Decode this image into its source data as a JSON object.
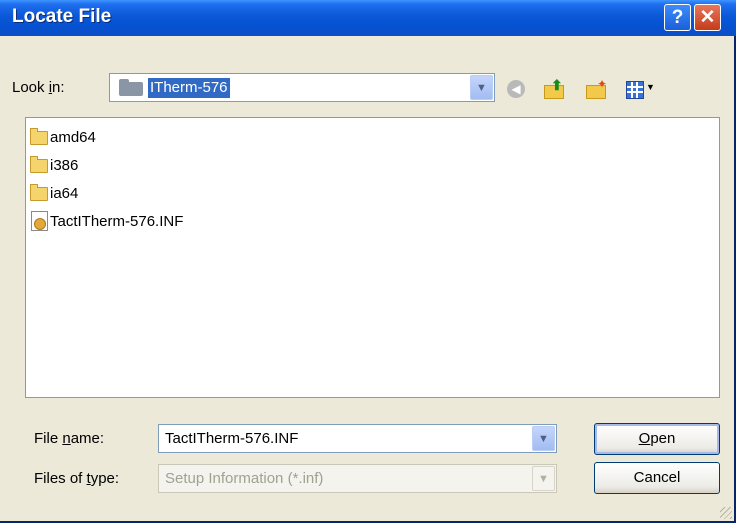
{
  "window": {
    "title": "Locate File"
  },
  "titlebar": {
    "help_glyph": "?",
    "close_glyph": "✕"
  },
  "lookin": {
    "label_pre": "Look ",
    "label_key": "i",
    "label_post": "n:",
    "value": "ITherm-576"
  },
  "toolbar": {
    "icons": [
      "back-icon",
      "up-folder-icon",
      "new-folder-icon",
      "views-menu-icon"
    ],
    "back_glyph": "◀"
  },
  "files": [
    {
      "name": "amd64",
      "kind": "folder"
    },
    {
      "name": "i386",
      "kind": "folder"
    },
    {
      "name": "ia64",
      "kind": "folder"
    },
    {
      "name": "TactITherm-576.INF",
      "kind": "inf-file"
    }
  ],
  "filename": {
    "label_pre": "File ",
    "label_key": "n",
    "label_post": "ame:",
    "value": "TactITherm-576.INF"
  },
  "filetype": {
    "label_pre": "Files of ",
    "label_key": "t",
    "label_post": "ype:",
    "value": "Setup Information (*.inf)"
  },
  "buttons": {
    "open_key": "O",
    "open_rest": "pen",
    "cancel": "Cancel"
  },
  "colors": {
    "title_bar": "#0a58d8",
    "selection": "#316ac5",
    "dialog_bg": "#ece9d8"
  }
}
